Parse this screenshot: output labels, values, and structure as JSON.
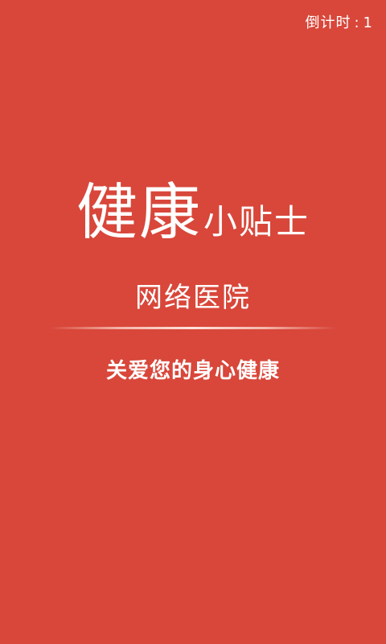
{
  "countdown": {
    "label": "倒计时",
    "separator": ":",
    "value": "1"
  },
  "logo": {
    "main": "健康",
    "suffix": "小贴士"
  },
  "subtitle": "网络医院",
  "slogan": "关爱您的身心健康",
  "colors": {
    "background": "#d8473a",
    "text": "#ffffff"
  }
}
